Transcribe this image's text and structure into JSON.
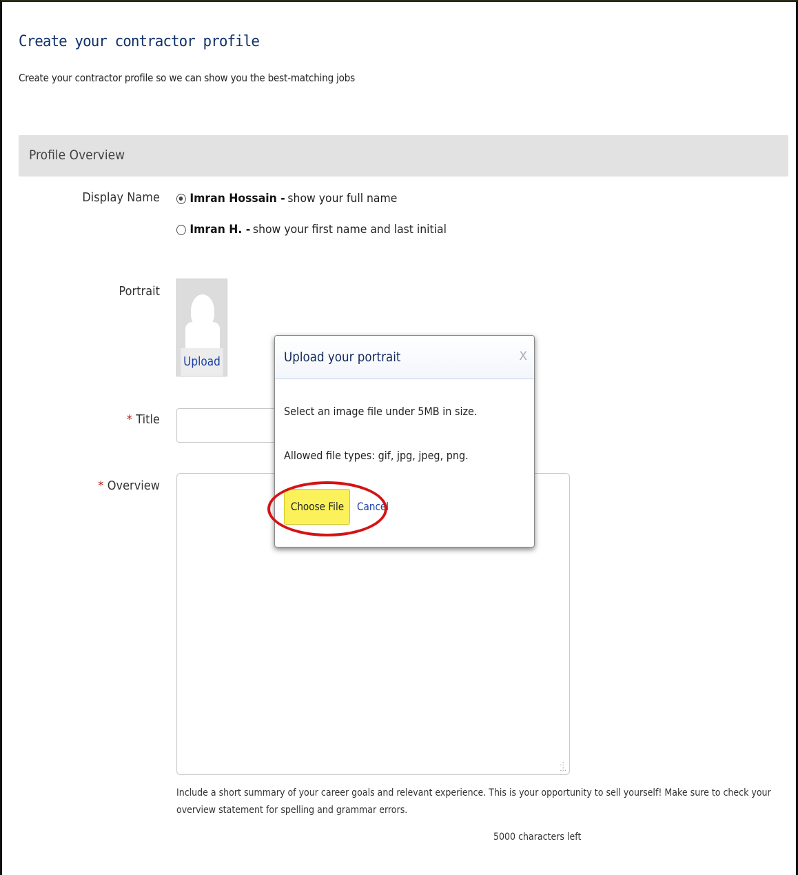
{
  "page": {
    "title": "Create your contractor profile",
    "subtitle": "Create your contractor profile so we can show you the best-matching jobs"
  },
  "section": {
    "title": "Profile Overview"
  },
  "display_name": {
    "label": "Display Name",
    "options": [
      {
        "name": "Imran Hossain -",
        "desc": "show your full name",
        "selected": true
      },
      {
        "name": "Imran H. -",
        "desc": "show your first name and last initial",
        "selected": false
      }
    ]
  },
  "portrait": {
    "label": "Portrait",
    "upload_label": "Upload"
  },
  "title_field": {
    "label": "Title",
    "required_marker": "*",
    "value": ""
  },
  "overview_field": {
    "label": "Overview",
    "required_marker": "*",
    "value": "",
    "helper": "Include a short summary of your career goals and relevant experience. This is your opportunity to sell yourself! Make sure to check your overview statement for spelling and grammar errors.",
    "chars_left": "5000 characters left"
  },
  "modal": {
    "title": "Upload your portrait",
    "close": "X",
    "line1": "Select an image file under 5MB in size.",
    "line2": "Allowed file types: gif, jpg, jpeg, png.",
    "choose_label": "Choose File",
    "cancel_label": "Cancel"
  },
  "colors": {
    "title": "#12326b",
    "required": "#c0201a",
    "link": "#1a3fa3",
    "highlight_button": "#fbf25b",
    "annotation_ring": "#d41313"
  }
}
